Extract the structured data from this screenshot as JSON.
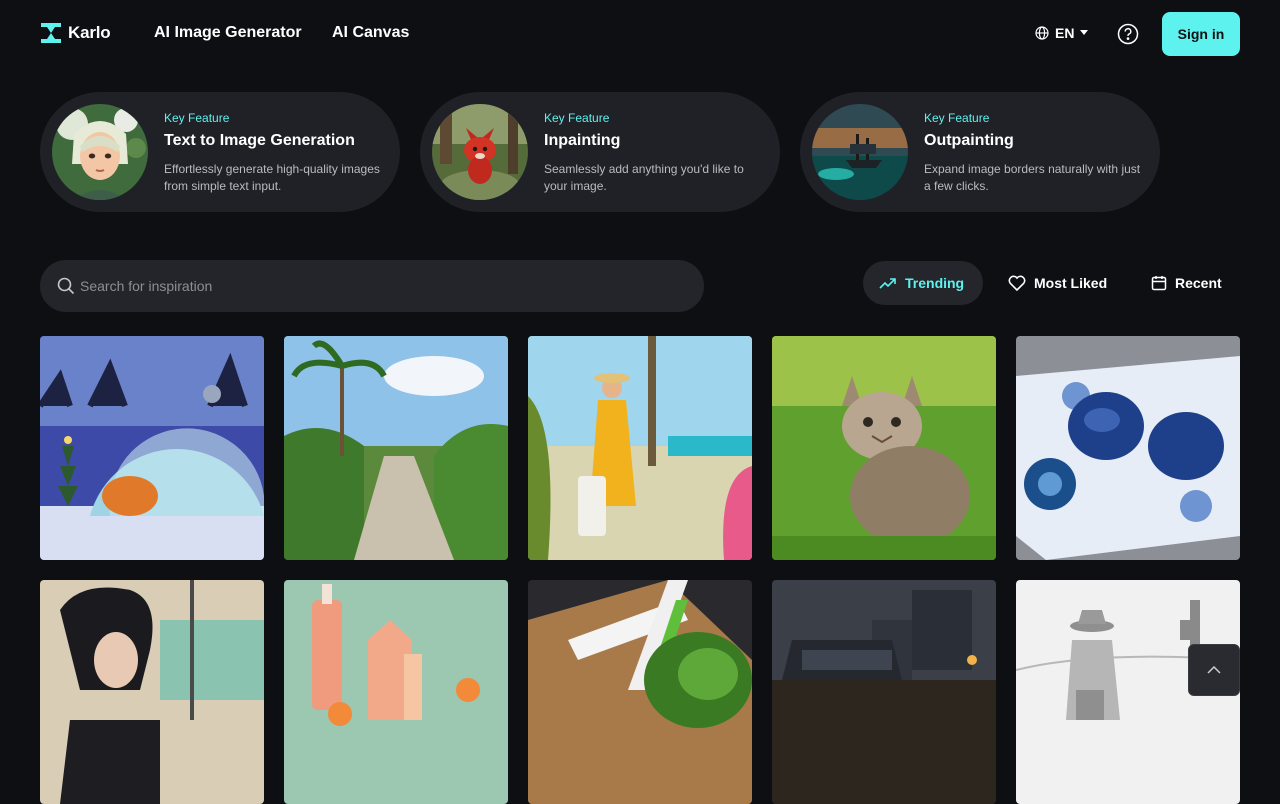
{
  "header": {
    "logo_text": "Karlo",
    "nav": [
      "AI Image Generator",
      "AI Canvas"
    ],
    "language": "EN",
    "signin_label": "Sign in"
  },
  "features": [
    {
      "kicker": "Key Feature",
      "title": "Text to Image Generation",
      "desc": "Effortlessly generate high-quality images from simple text input."
    },
    {
      "kicker": "Key Feature",
      "title": "Inpainting",
      "desc": "Seamlessly add anything you'd like to your image."
    },
    {
      "kicker": "Key Feature",
      "title": "Outpainting",
      "desc": "Expand image borders naturally with just a few clicks."
    }
  ],
  "search": {
    "placeholder": "Search for inspiration"
  },
  "filters": [
    {
      "label": "Trending",
      "icon": "trending-up-icon",
      "active": true
    },
    {
      "label": "Most Liked",
      "icon": "heart-icon",
      "active": false
    },
    {
      "label": "Recent",
      "icon": "calendar-icon",
      "active": false
    }
  ],
  "gallery": [
    {
      "subject": "glowing dome igloo at night with christmas tree"
    },
    {
      "subject": "tropical dirt road with palm trees"
    },
    {
      "subject": "woman in yellow dress with suitcase under palms"
    },
    {
      "subject": "tabby kitten sitting on grass"
    },
    {
      "subject": "blue patterned sunglasses on blue and white cloth"
    },
    {
      "subject": "anime man with black hair, painted background"
    },
    {
      "subject": "peach cosmetic bottles product scene"
    },
    {
      "subject": "gift box with white ribbon and plant"
    },
    {
      "subject": "dark industrial vehicle scene"
    },
    {
      "subject": "pencil sketch of cowboy in desert"
    }
  ],
  "colors": {
    "accent": "#5ef2ee",
    "background": "#0e0f13",
    "card": "#202127"
  }
}
